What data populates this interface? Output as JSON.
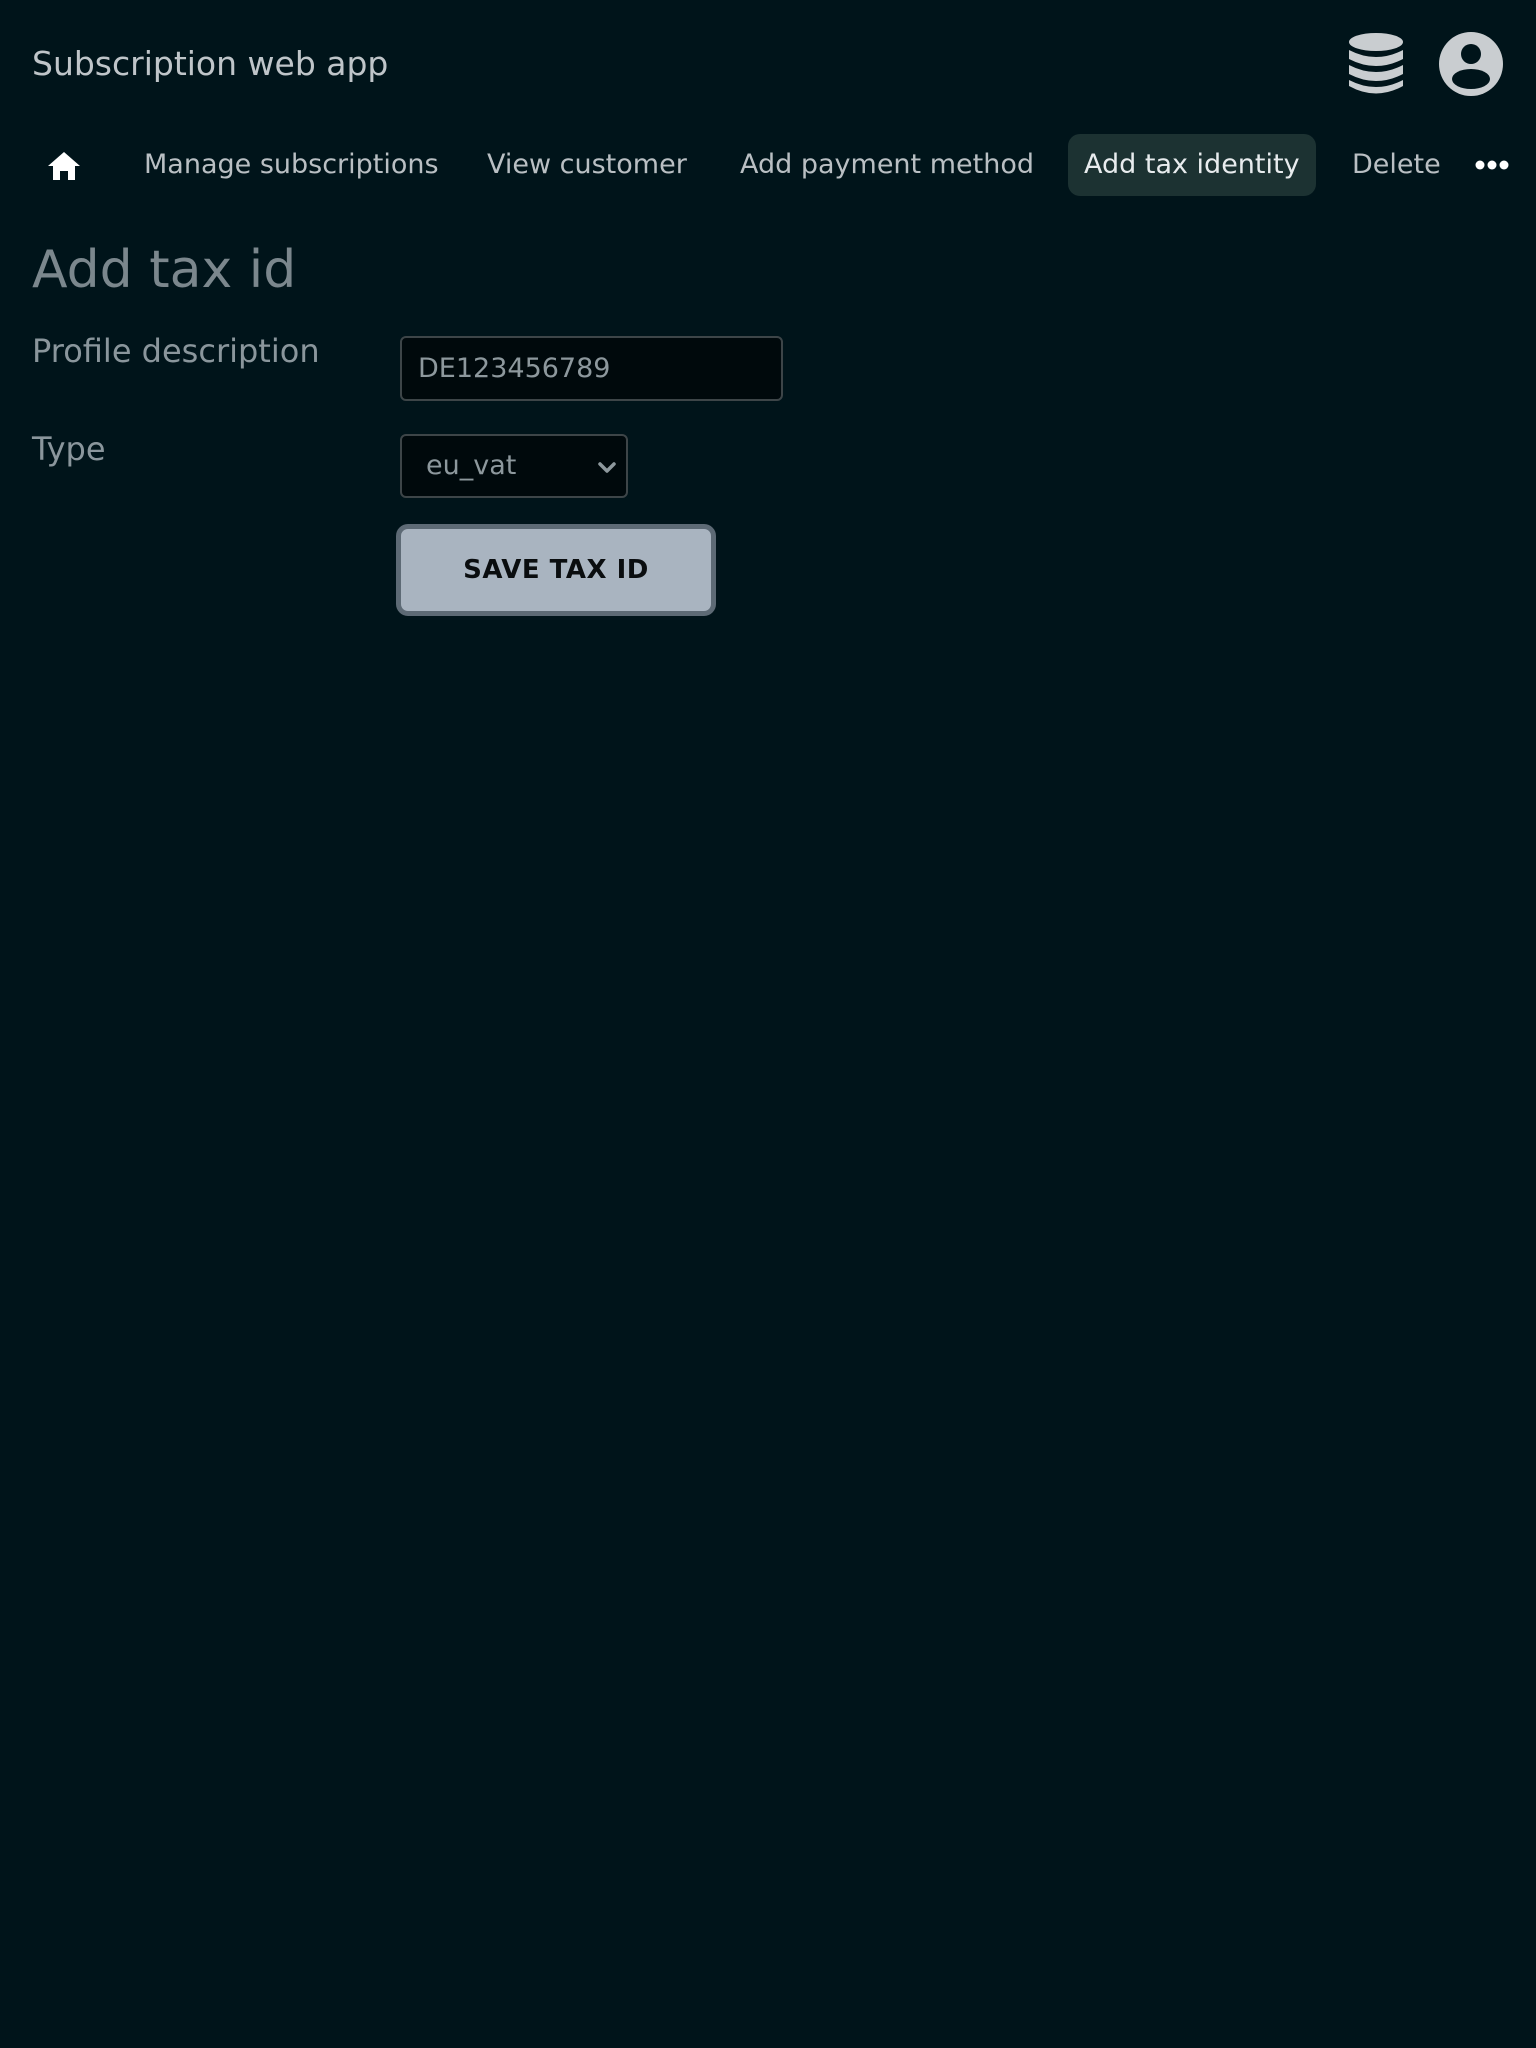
{
  "header": {
    "title": "Subscription web app",
    "icons": [
      "database-icon",
      "account-circle-icon"
    ]
  },
  "nav": {
    "home_icon": "home-icon",
    "items": [
      {
        "label": "Manage subscriptions",
        "active": false
      },
      {
        "label": "View customer",
        "active": false
      },
      {
        "label": "Add payment method",
        "active": false
      },
      {
        "label": "Add tax identity",
        "active": true
      },
      {
        "label": "Delete",
        "active": false
      }
    ],
    "more_icon": "more-horizontal-icon"
  },
  "form": {
    "title": "Add tax id",
    "description_label": "Profile description",
    "description_placeholder": "DE123456789",
    "description_value": "",
    "type_label": "Type",
    "type_value": "eu_vat",
    "save_label": "SAVE TAX ID"
  },
  "colors": {
    "background": "#00141a",
    "active_tab": "#1c3232",
    "button": "#a9b4c0",
    "button_border": "#5d6a75"
  }
}
